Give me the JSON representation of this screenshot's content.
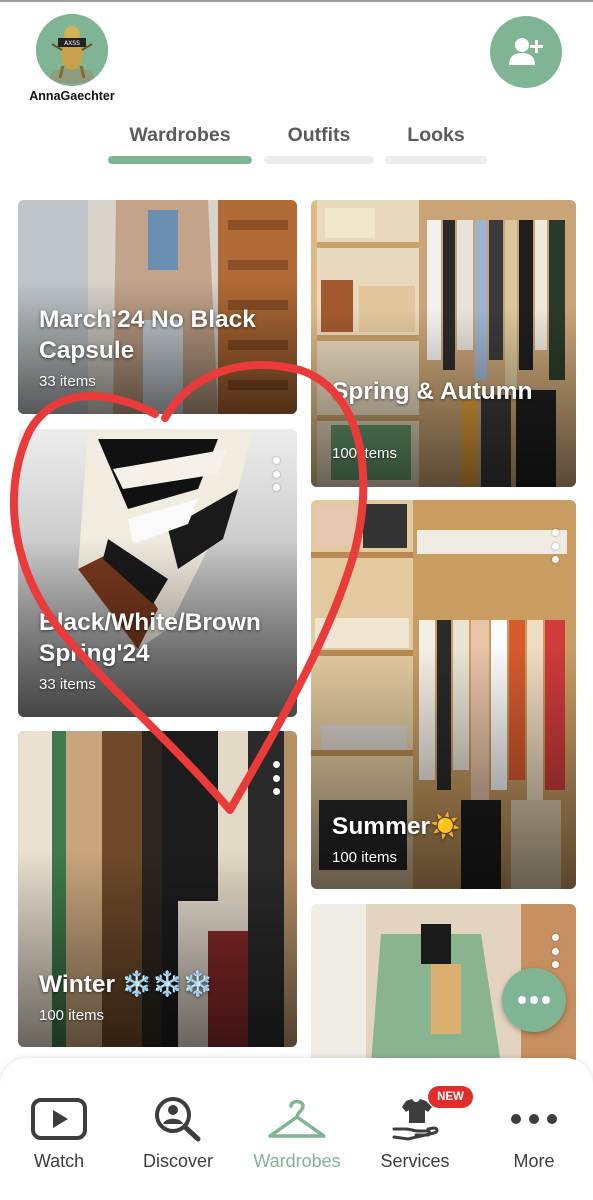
{
  "header": {
    "username": "AnnaGaechter",
    "avatar_badge": "AXSS",
    "add_user_icon": "add-user-icon"
  },
  "tabs": [
    {
      "label": "Wardrobes",
      "active": true
    },
    {
      "label": "Outfits",
      "active": false
    },
    {
      "label": "Looks",
      "active": false
    }
  ],
  "wardrobes": [
    {
      "title": "March'24 No Black Capsule",
      "count": "33 items"
    },
    {
      "title": "Spring & Autumn",
      "count": "100 items"
    },
    {
      "title": "Black/White/Brown Spring'24",
      "count": "33 items"
    },
    {
      "title": "Summer☀️",
      "count": "100 items"
    },
    {
      "title": "Winter ❄️❄️❄️",
      "count": "100 items"
    },
    {
      "title": "",
      "count": ""
    }
  ],
  "bottom_nav": [
    {
      "label": "Watch",
      "icon": "play-icon"
    },
    {
      "label": "Discover",
      "icon": "person-search-icon"
    },
    {
      "label": "Wardrobes",
      "icon": "hanger-icon",
      "active": true
    },
    {
      "label": "Services",
      "icon": "shirt-hand-icon",
      "badge": "NEW"
    },
    {
      "label": "More",
      "icon": "more-dots-icon"
    }
  ],
  "colors": {
    "accent": "#7fb495",
    "badge": "#e32d2d",
    "heart_annotation": "#ea3a3a"
  }
}
